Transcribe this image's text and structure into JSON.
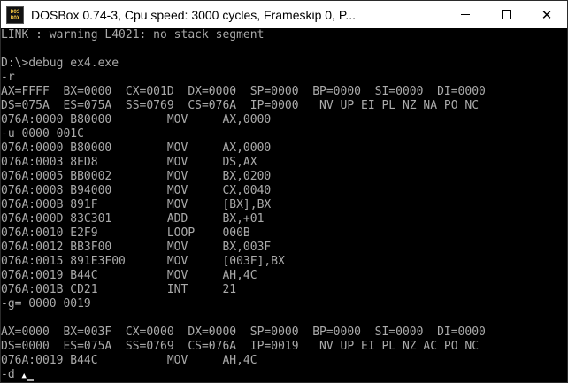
{
  "titlebar": {
    "app_icon_text_top": "DOS",
    "app_icon_text_bottom": "BOX",
    "title": "DOSBox 0.74-3, Cpu speed:     3000 cycles, Frameskip  0, P..."
  },
  "window_controls": {
    "minimize_icon": "minimize-icon",
    "maximize_icon": "maximize-icon",
    "close_label": "✕"
  },
  "terminal": {
    "lines": [
      "LINK : warning L4021: no stack segment",
      "",
      "D:\\>debug ex4.exe",
      "-r",
      "AX=FFFF  BX=0000  CX=001D  DX=0000  SP=0000  BP=0000  SI=0000  DI=0000",
      "DS=075A  ES=075A  SS=0769  CS=076A  IP=0000   NV UP EI PL NZ NA PO NC",
      "076A:0000 B80000        MOV     AX,0000",
      "-u 0000 001C",
      "076A:0000 B80000        MOV     AX,0000",
      "076A:0003 8ED8          MOV     DS,AX",
      "076A:0005 BB0002        MOV     BX,0200",
      "076A:0008 B94000        MOV     CX,0040",
      "076A:000B 891F          MOV     [BX],BX",
      "076A:000D 83C301        ADD     BX,+01",
      "076A:0010 E2F9          LOOP    000B",
      "076A:0012 BB3F00        MOV     BX,003F",
      "076A:0015 891E3F00      MOV     [003F],BX",
      "076A:0019 B44C          MOV     AH,4C",
      "076A:001B CD21          INT     21",
      "-g= 0000 0019",
      "",
      "AX=0000  BX=003F  CX=0000  DX=0000  SP=0000  BP=0000  SI=0000  DI=0000",
      "DS=0000  ES=075A  SS=0769  CS=076A  IP=0019   NV UP EI PL NZ AC PO NC",
      "076A:0019 B44C          MOV     AH,4C"
    ],
    "prompt_line": "-d ",
    "mouse_glyph": "▲"
  }
}
